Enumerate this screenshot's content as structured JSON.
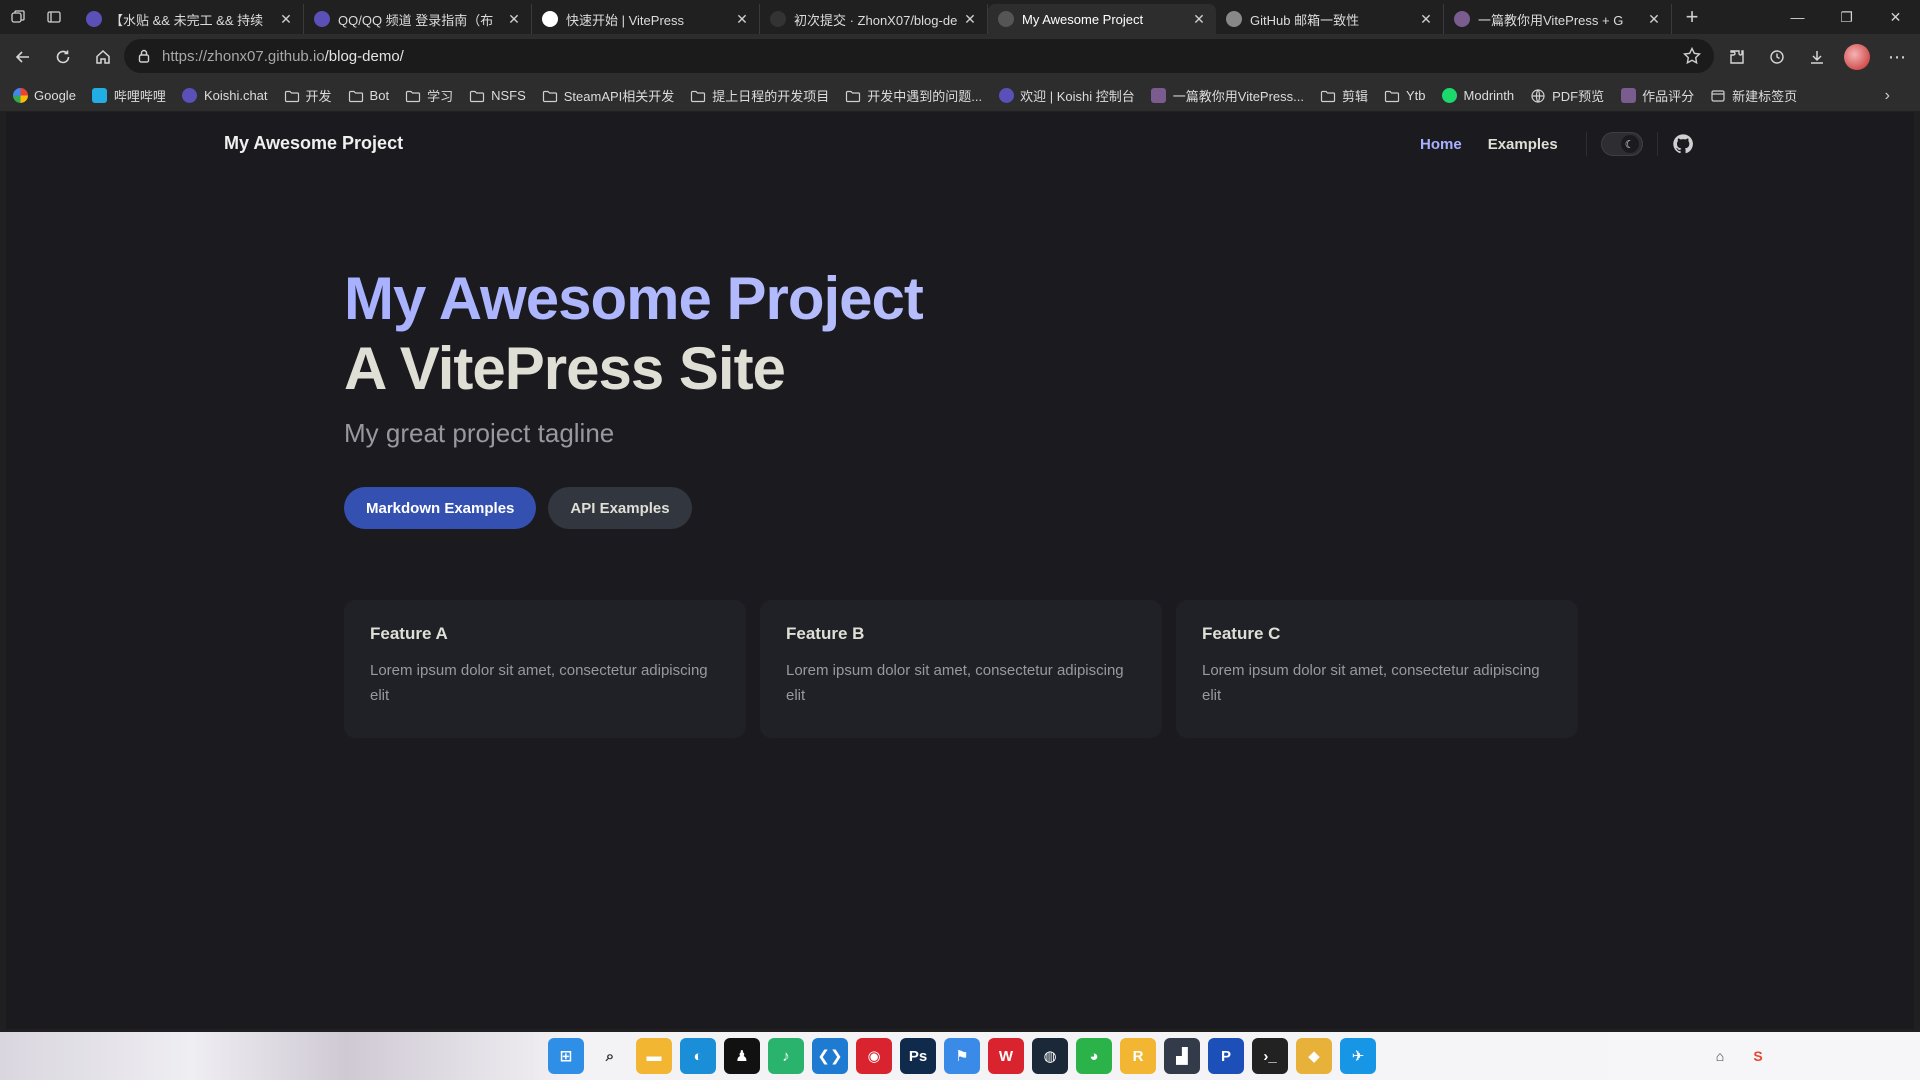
{
  "browser": {
    "tabs": [
      {
        "title": "【水贴 && 未完工 && 持续",
        "favicon_color": "#5b4fb8",
        "active": false
      },
      {
        "title": "QQ/QQ 频道 登录指南（布",
        "favicon_color": "#5b4fb8",
        "active": false
      },
      {
        "title": "快速开始 | VitePress",
        "favicon_color": "#ffffff",
        "active": false
      },
      {
        "title": "初次提交 · ZhonX07/blog-de",
        "favicon_color": "#333333",
        "active": false
      },
      {
        "title": "My Awesome Project",
        "favicon_color": "#555555",
        "active": true
      },
      {
        "title": "GitHub 邮箱一致性",
        "favicon_color": "#888888",
        "active": false
      },
      {
        "title": "一篇教你用VitePress + G",
        "favicon_color": "#7a5c8e",
        "active": false
      }
    ],
    "url_host": "https://zhonx07.github.io",
    "url_path": "/blog-demo/",
    "bookmarks": [
      {
        "label": "Google",
        "kind": "google"
      },
      {
        "label": "哔哩哔哩",
        "kind": "bili"
      },
      {
        "label": "Koishi.chat",
        "kind": "koishi"
      },
      {
        "label": "开发",
        "kind": "folder"
      },
      {
        "label": "Bot",
        "kind": "folder"
      },
      {
        "label": "学习",
        "kind": "folder"
      },
      {
        "label": "NSFS",
        "kind": "folder"
      },
      {
        "label": "SteamAPI相关开发",
        "kind": "folder"
      },
      {
        "label": "提上日程的开发项目",
        "kind": "folder"
      },
      {
        "label": "开发中遇到的问题...",
        "kind": "folder"
      },
      {
        "label": "欢迎 | Koishi 控制台",
        "kind": "koishi"
      },
      {
        "label": "一篇教你用VitePress...",
        "kind": "page"
      },
      {
        "label": "剪辑",
        "kind": "folder"
      },
      {
        "label": "Ytb",
        "kind": "folder"
      },
      {
        "label": "Modrinth",
        "kind": "modrinth"
      },
      {
        "label": "PDF预览",
        "kind": "globe"
      },
      {
        "label": "作品评分",
        "kind": "page"
      },
      {
        "label": "新建标签页",
        "kind": "newtab"
      }
    ]
  },
  "site": {
    "title": "My Awesome Project",
    "nav": {
      "home": "Home",
      "examples": "Examples"
    },
    "hero": {
      "name": "My Awesome Project",
      "text": "A VitePress Site",
      "tagline": "My great project tagline",
      "primary_action": "Markdown Examples",
      "secondary_action": "API Examples"
    },
    "features": [
      {
        "title": "Feature A",
        "details": "Lorem ipsum dolor sit amet, consectetur adipiscing elit"
      },
      {
        "title": "Feature B",
        "details": "Lorem ipsum dolor sit amet, consectetur adipiscing elit"
      },
      {
        "title": "Feature C",
        "details": "Lorem ipsum dolor sit amet, consectetur adipiscing elit"
      }
    ]
  },
  "taskbar": {
    "apps": [
      {
        "icon": "windows-start-icon",
        "color": "#2f8fe6",
        "glyph": "⊞"
      },
      {
        "icon": "search-icon",
        "color": "#333333",
        "glyph": "⌕"
      },
      {
        "icon": "file-explorer-icon",
        "color": "#f2b632",
        "glyph": "▬"
      },
      {
        "icon": "edge-icon",
        "color": "#1a8fd8",
        "glyph": "◐"
      },
      {
        "icon": "qq-icon",
        "color": "#111111",
        "glyph": "♟"
      },
      {
        "icon": "music-icon",
        "color": "#29b36c",
        "glyph": "♪"
      },
      {
        "icon": "vscode-icon",
        "color": "#1f7ad1",
        "glyph": "❮❯"
      },
      {
        "icon": "netease-music-icon",
        "color": "#d9232e",
        "glyph": "◉"
      },
      {
        "icon": "photoshop-icon",
        "color": "#0f2a4a",
        "glyph": "Ps"
      },
      {
        "icon": "bookmark-app-icon",
        "color": "#3a8be8",
        "glyph": "⚑"
      },
      {
        "icon": "wps-icon",
        "color": "#d9232e",
        "glyph": "W"
      },
      {
        "icon": "steam-icon",
        "color": "#1b2838",
        "glyph": "◍"
      },
      {
        "icon": "wechat-icon",
        "color": "#2bb34a",
        "glyph": "◕"
      },
      {
        "icon": "rockstar-icon",
        "color": "#f2b632",
        "glyph": "R"
      },
      {
        "icon": "terminal-app-icon",
        "color": "#333a4a",
        "glyph": "▟"
      },
      {
        "icon": "pixel-app-icon",
        "color": "#1d4fb8",
        "glyph": "P"
      },
      {
        "icon": "terminal-icon",
        "color": "#222222",
        "glyph": "›_"
      },
      {
        "icon": "git-icon",
        "color": "#e8b23a",
        "glyph": "◆"
      },
      {
        "icon": "feishu-icon",
        "color": "#1796e6",
        "glyph": "✈"
      }
    ]
  }
}
